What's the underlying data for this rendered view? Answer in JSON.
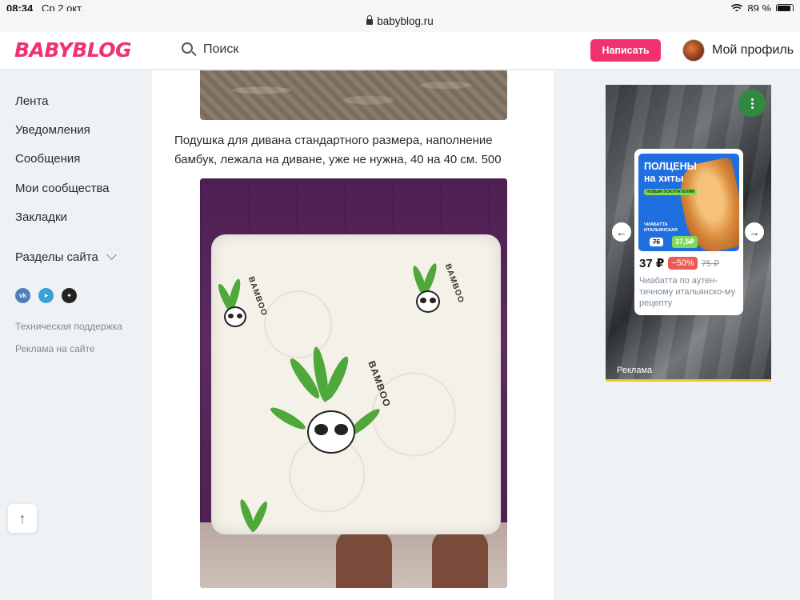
{
  "status": {
    "time": "08:34",
    "date": "Ср 2 окт.",
    "battery": "89 %"
  },
  "browser": {
    "url": "babyblog.ru"
  },
  "header": {
    "logo": "BABYBLOG",
    "search_label": "Поиск",
    "write_button": "Написать",
    "profile_label": "Мой профиль"
  },
  "sidebar": {
    "items": [
      {
        "label": "Лента"
      },
      {
        "label": "Уведомления"
      },
      {
        "label": "Сообщения"
      },
      {
        "label": "Мои сообщества"
      },
      {
        "label": "Закладки"
      }
    ],
    "sections_label": "Разделы сайта",
    "socials": [
      "vk-icon",
      "telegram-icon",
      "zen-icon"
    ],
    "support_link": "Техническая поддержка",
    "ads_link": "Реклама на сайте"
  },
  "post": {
    "text": "Подушка для дивана стандартного размера, наполнение бамбук, лежала на диване, уже не нужна, 40 на 40 см. 500",
    "pillow_label": "BAMBOO"
  },
  "ad": {
    "banner_title_1": "ПОЛЦЕНЫ",
    "banner_title_2": "на хиты",
    "banner_pill": "НОВЫМ ПОКУПАТЕЛЯМ",
    "banner_product_1": "ЧИАБАТТА",
    "banner_product_2": "ИТАЛЬЯНСКАЯ",
    "banner_old_price": "75",
    "banner_new_price": "37,5₽",
    "price": "37 ₽",
    "discount": "−50%",
    "old_price": "75 ₽",
    "description": "Чиабатта по аутен-тичному итальянско-му рецепту",
    "label": "Реклама",
    "prev_arrow": "←",
    "next_arrow": "→"
  },
  "scroll_up_icon": "↑",
  "colors": {
    "brand": "#f0336e",
    "page_bg": "#eef2f5",
    "ad_accent": "#f4c61a"
  }
}
